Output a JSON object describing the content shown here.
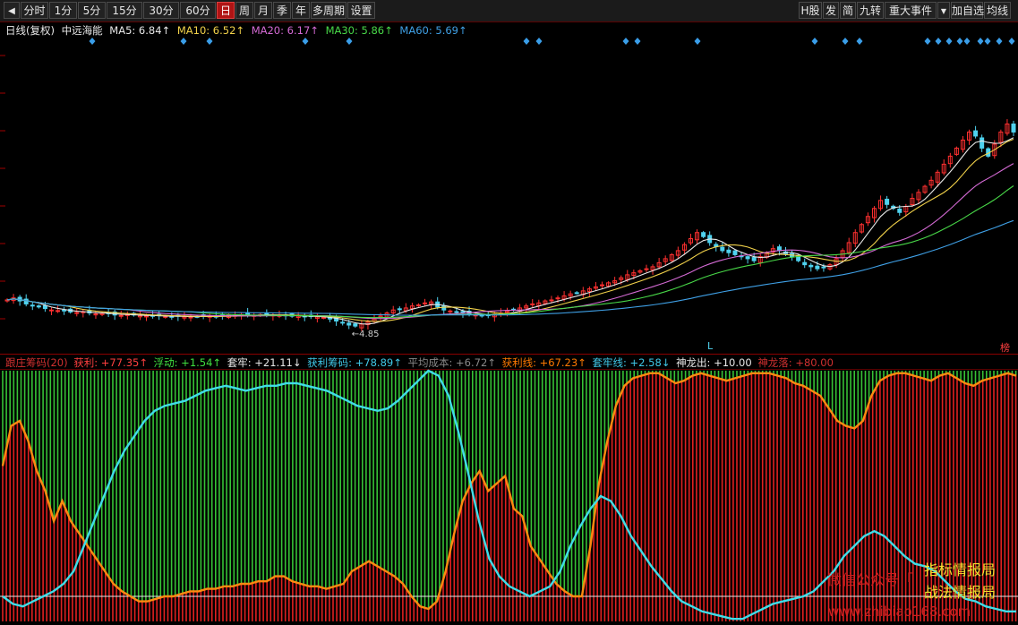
{
  "toolbar": {
    "back_icon": "back-arrow-icon",
    "periods": [
      "分时",
      "1分",
      "5分",
      "15分",
      "30分",
      "60分",
      "日",
      "周",
      "月",
      "季",
      "年",
      "多周期",
      "设置"
    ],
    "active_period": "日",
    "right_buttons": [
      "H股",
      "发",
      "简",
      "九转",
      "重大事件",
      "加自选",
      "均线"
    ],
    "dropdown_icon": "dropdown-arrow-icon"
  },
  "main_panel": {
    "header_prefix": "日线(复权)",
    "stock_name": "中远海能",
    "ma": [
      {
        "label": "MA5: 6.84↑",
        "color": "#e8e8e8"
      },
      {
        "label": "MA10: 6.52↑",
        "color": "#f2d24a"
      },
      {
        "label": "MA20: 6.17↑",
        "color": "#d46ad4"
      },
      {
        "label": "MA30: 5.86↑",
        "color": "#48d848"
      },
      {
        "label": "MA60: 5.69↑",
        "color": "#3fa0e6"
      }
    ],
    "low_label": "4.85",
    "marker_L": "L",
    "marker_right": "榜",
    "colors": {
      "up": "#ff3030",
      "down": "#4fd2ef",
      "diamond": "#3a9ee8"
    },
    "kline": [
      6.25,
      6.35,
      6.2,
      6.05,
      5.95,
      5.9,
      5.82,
      5.75,
      5.72,
      5.7,
      5.65,
      5.62,
      5.66,
      5.6,
      5.55,
      5.58,
      5.56,
      5.5,
      5.48,
      5.52,
      5.5,
      5.47,
      5.45,
      5.44,
      5.46,
      5.43,
      5.42,
      5.44,
      5.41,
      5.4,
      5.42,
      5.45,
      5.44,
      5.43,
      5.47,
      5.5,
      5.48,
      5.52,
      5.5,
      5.48,
      5.52,
      5.55,
      5.5,
      5.48,
      5.46,
      5.44,
      5.45,
      5.43,
      5.42,
      5.4,
      5.38,
      5.3,
      5.2,
      5.1,
      5.0,
      4.95,
      5.05,
      5.15,
      5.3,
      5.45,
      5.6,
      5.75,
      5.8,
      5.85,
      5.95,
      6.0,
      6.1,
      6.15,
      5.9,
      5.75,
      5.7,
      5.65,
      5.6,
      5.55,
      5.5,
      5.45,
      5.5,
      5.55,
      5.6,
      5.7,
      5.75,
      5.85,
      5.95,
      6.05,
      6.1,
      6.2,
      6.25,
      6.35,
      6.45,
      6.55,
      6.6,
      6.7,
      6.8,
      6.9,
      7.0,
      7.1,
      7.2,
      7.35,
      7.5,
      7.6,
      7.7,
      7.8,
      7.9,
      8.1,
      8.3,
      8.5,
      8.7,
      9.0,
      9.3,
      9.6,
      9.4,
      9.1,
      8.9,
      8.7,
      8.6,
      8.5,
      8.4,
      8.3,
      8.2,
      8.4,
      8.6,
      8.8,
      8.7,
      8.55,
      8.4,
      8.2,
      8.0,
      7.9,
      7.8,
      7.85,
      8.0,
      8.3,
      8.7,
      9.1,
      9.6,
      10.0,
      10.4,
      10.8,
      11.2,
      11.0,
      10.8,
      10.6,
      10.9,
      11.3,
      11.6,
      11.9,
      12.2,
      12.6,
      13.0,
      13.4,
      13.8,
      14.2,
      14.6,
      14.4,
      13.8,
      13.4,
      14.0,
      14.6,
      15.0,
      14.6
    ]
  },
  "diamond_rows": [
    {
      "label": "top-diamonds",
      "xs": [
        103,
        205,
        234,
        341,
        390,
        588,
        602,
        699,
        712,
        779,
        910,
        944,
        960,
        1036,
        1048,
        1060,
        1072,
        1080,
        1095,
        1103,
        1116,
        1130
      ]
    }
  ],
  "sub_panel": {
    "title": "跟庄筹码(20)",
    "items": [
      {
        "label": "获利: +77.35↑",
        "color": "#ff4040"
      },
      {
        "label": "浮动: +1.54↑",
        "color": "#40e040"
      },
      {
        "label": "套牢: +21.11↓",
        "color": "#e8e8e8"
      },
      {
        "label": "获利筹码: +78.89↑",
        "color": "#40c8e8"
      },
      {
        "label": "平均成本: +6.72↑",
        "color": "#888888"
      },
      {
        "label": "获利线: +67.23↑",
        "color": "#ff7a00"
      },
      {
        "label": "套牢线: +2.58↓",
        "color": "#40c8e8"
      },
      {
        "label": "神龙出: +10.00",
        "color": "#e8e8e8"
      },
      {
        "label": "神龙落: +80.00",
        "color": "#d03030"
      }
    ],
    "colors": {
      "profit": "#e02020",
      "loss": "#36c236",
      "profit_line": "#ff8a10",
      "trap_line": "#40dde8",
      "level": "#e8e8e8"
    },
    "profit_pct": [
      62,
      78,
      80,
      72,
      60,
      52,
      40,
      48,
      40,
      35,
      30,
      25,
      20,
      15,
      12,
      10,
      8,
      8,
      9,
      10,
      10,
      11,
      12,
      12,
      13,
      13,
      14,
      14,
      15,
      15,
      16,
      16,
      18,
      18,
      16,
      15,
      14,
      14,
      13,
      14,
      15,
      20,
      22,
      24,
      22,
      20,
      18,
      15,
      10,
      6,
      5,
      8,
      20,
      35,
      48,
      55,
      60,
      52,
      55,
      58,
      45,
      42,
      30,
      25,
      20,
      15,
      12,
      10,
      10,
      30,
      55,
      72,
      86,
      94,
      97,
      98,
      99,
      99,
      97,
      95,
      96,
      98,
      99,
      98,
      97,
      96,
      97,
      98,
      99,
      99,
      99,
      98,
      97,
      95,
      94,
      92,
      90,
      85,
      80,
      78,
      77,
      80,
      90,
      96,
      98,
      99,
      99,
      98,
      97,
      96,
      98,
      99,
      97,
      95,
      94,
      96,
      97,
      98,
      99,
      98
    ],
    "trap_pct": [
      10,
      7,
      6,
      8,
      10,
      12,
      15,
      20,
      30,
      40,
      50,
      60,
      68,
      74,
      80,
      84,
      86,
      87,
      88,
      90,
      92,
      93,
      94,
      93,
      92,
      93,
      94,
      94,
      95,
      95,
      94,
      93,
      92,
      90,
      88,
      86,
      85,
      84,
      85,
      88,
      92,
      96,
      100,
      98,
      90,
      75,
      58,
      40,
      25,
      18,
      14,
      12,
      10,
      12,
      14,
      20,
      30,
      38,
      45,
      50,
      48,
      42,
      34,
      28,
      22,
      17,
      12,
      8,
      6,
      4,
      3,
      2,
      1,
      1,
      3,
      5,
      7,
      8,
      9,
      10,
      12,
      16,
      20,
      26,
      30,
      34,
      36,
      34,
      30,
      26,
      23,
      22,
      20,
      16,
      12,
      9,
      8,
      6,
      5,
      4,
      4
    ],
    "level_pct": 10
  },
  "watermark": {
    "line1_left": "微信公众号「",
    "line1_right": "指标情报局",
    "line2": "战法情报局",
    "line3": "www.zhibiao168.com"
  }
}
